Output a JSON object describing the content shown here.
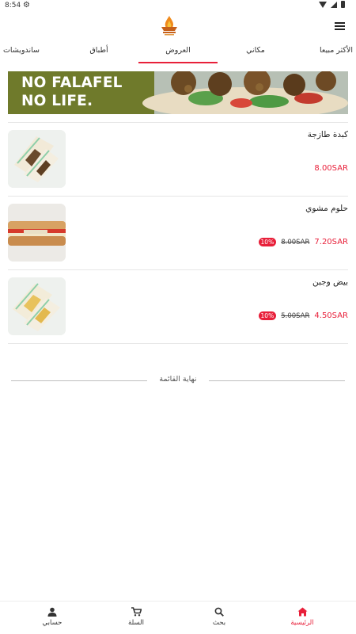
{
  "status_bar": {
    "time": "8:54"
  },
  "header": {
    "logo_icon": "restaurant-logo-icon",
    "menu_icon": "hamburger-menu-icon"
  },
  "tabs": [
    {
      "label": "ساندويشات",
      "active": false
    },
    {
      "label": "أطباق",
      "active": false
    },
    {
      "label": "العروض",
      "active": true
    },
    {
      "label": "مكاني",
      "active": false
    },
    {
      "label": "الأكثر مبيعا",
      "active": false
    }
  ],
  "banner": {
    "line1": "NO FALAFEL",
    "line2": "NO LIFE."
  },
  "items": [
    {
      "name": "كبدة طازجة",
      "price": "8.00SAR",
      "old_price": "",
      "discount": ""
    },
    {
      "name": "حلوم مشوي",
      "price": "7.20SAR",
      "old_price": "8.00SAR",
      "discount": "10%"
    },
    {
      "name": "بيض وجبن",
      "price": "4.50SAR",
      "old_price": "5.00SAR",
      "discount": "10%"
    }
  ],
  "end_of_list": "نهاية القائمة",
  "bottom_nav": [
    {
      "label": "حسابي",
      "icon": "person-icon",
      "active": false
    },
    {
      "label": "السلة",
      "icon": "cart-icon",
      "active": false
    },
    {
      "label": "بحث",
      "icon": "search-icon",
      "active": false
    },
    {
      "label": "الرئيسية",
      "icon": "home-icon",
      "active": true
    }
  ],
  "colors": {
    "accent": "#e8203a",
    "banner_green": "#6f7a2b"
  }
}
